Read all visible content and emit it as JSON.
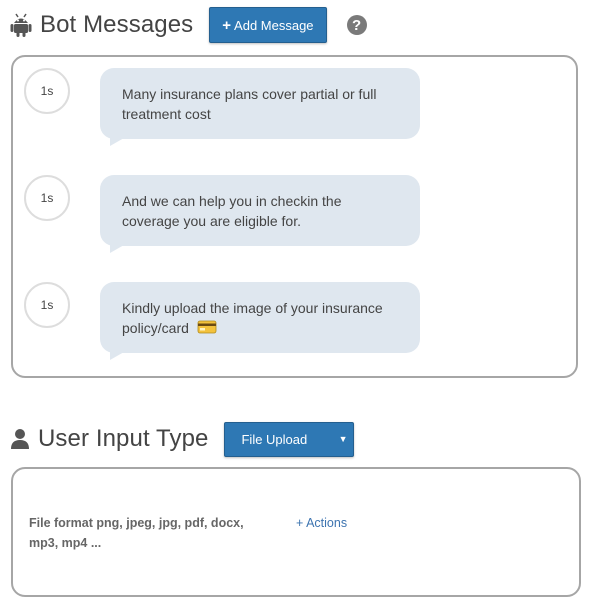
{
  "bot_messages": {
    "title": "Bot Messages",
    "add_button_label": "Add Message",
    "help_label": "?",
    "messages": [
      {
        "delay": "1s",
        "text": "Many insurance plans cover partial or full treatment cost"
      },
      {
        "delay": "1s",
        "text": "And we can help you in checkin the coverage you are eligible for."
      },
      {
        "delay": "1s",
        "text": "Kindly upload the image of your insurance policy/card"
      }
    ]
  },
  "user_input": {
    "title": "User Input Type",
    "selected_type": "File Upload",
    "file_format_text": "File format png, jpeg, jpg, pdf, docx, mp3, mp4 ...",
    "actions_label": "+ Actions"
  },
  "colors": {
    "accent": "#2e78b4",
    "bubble": "#dfe7ef",
    "border": "#a6a6a6",
    "link": "#3d74b0"
  }
}
